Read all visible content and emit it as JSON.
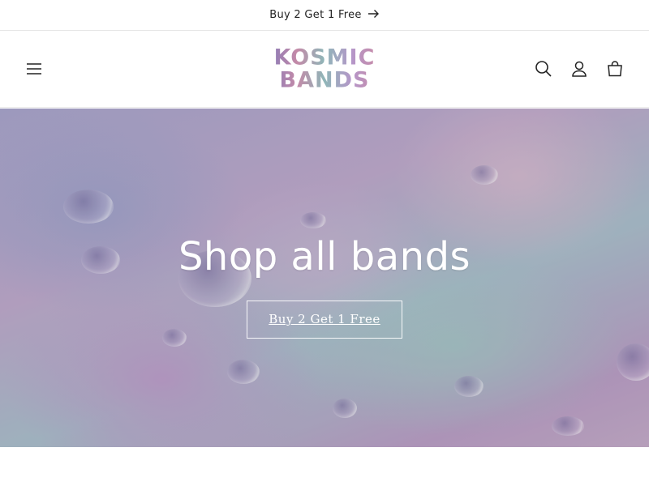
{
  "announcement": {
    "text": "Buy 2 Get 1 Free"
  },
  "header": {
    "logo_line1": "KOSMIC",
    "logo_line2": "BANDS",
    "icons": [
      "menu-icon",
      "search-icon",
      "account-icon",
      "cart-icon"
    ]
  },
  "hero": {
    "title": "Shop all bands",
    "button_label": "Buy 2 Get 1 Free"
  },
  "colors": {
    "text": "#121212",
    "hero_text": "#ffffff",
    "logo_gradient": [
      "#8a7bb8",
      "#c48aa8",
      "#8fb6b8",
      "#b596c9"
    ]
  }
}
